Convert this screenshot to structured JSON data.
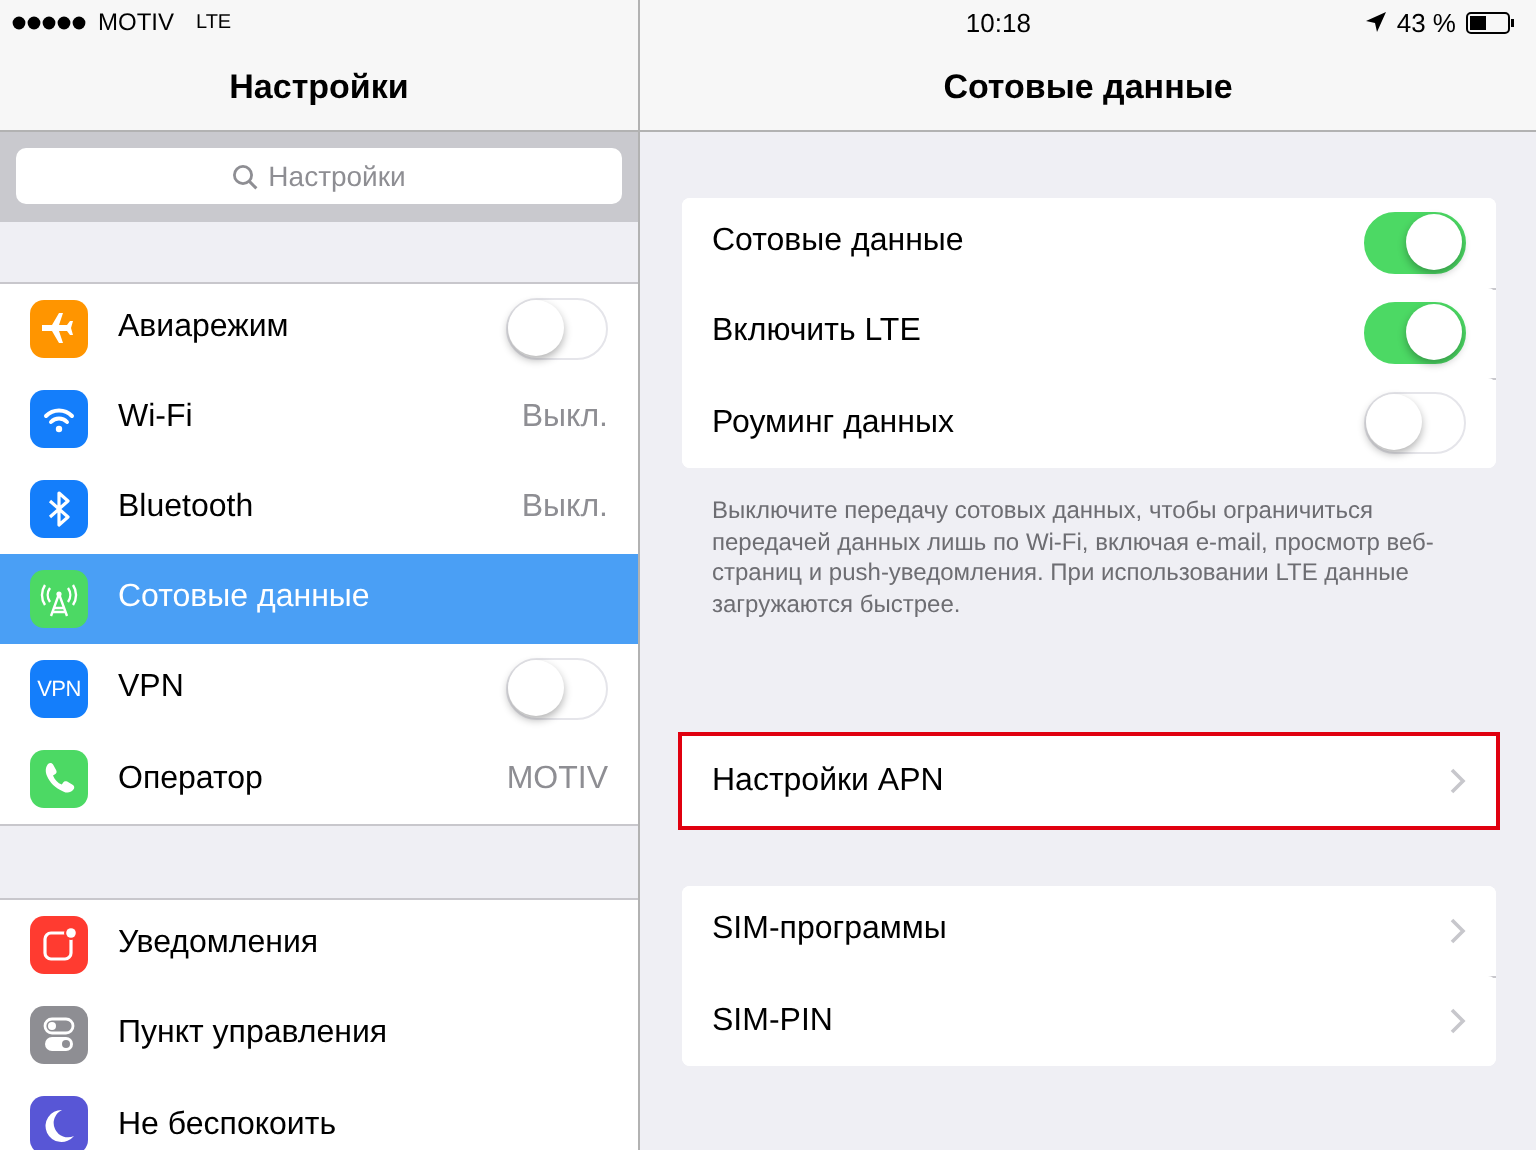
{
  "status_bar": {
    "carrier": "MOTIV",
    "network": "LTE",
    "time": "10:18",
    "battery": "43 %"
  },
  "left": {
    "title": "Настройки",
    "search": {
      "placeholder": "Настройки"
    },
    "groups": [
      [
        {
          "color": "#ff9500",
          "label": "Авиарежим",
          "kind": "toggle",
          "on": false,
          "selected": false
        },
        {
          "color": "#147efb",
          "label": "Wi-Fi",
          "kind": "value",
          "value": "Выкл.",
          "selected": false
        },
        {
          "color": "#147efb",
          "label": "Bluetooth",
          "kind": "value",
          "value": "Выкл.",
          "selected": false
        },
        {
          "color": "#4cd964",
          "label": "Сотовые данные",
          "kind": "plain",
          "selected": true
        },
        {
          "color": "#147efb",
          "icon_text": "VPN",
          "label": "VPN",
          "kind": "toggle",
          "on": false,
          "selected": false
        },
        {
          "color": "#4cd964",
          "label": "Оператор",
          "kind": "value",
          "value": "MOTIV",
          "selected": false
        }
      ],
      [
        {
          "color": "#ff3b30",
          "label": "Уведомления",
          "kind": "plain",
          "selected": false
        },
        {
          "color": "#8e8e93",
          "label": "Пункт управления",
          "kind": "plain",
          "selected": false
        },
        {
          "color": "#5856d6",
          "label": "Не беспокоить",
          "kind": "plain",
          "selected": false
        }
      ]
    ]
  },
  "right": {
    "title": "Сотовые данные",
    "groups": [
      {
        "rows": [
          {
            "label": "Сотовые данные",
            "kind": "toggle",
            "on": true
          },
          {
            "label": "Включить LTE",
            "kind": "toggle",
            "on": true
          },
          {
            "label": "Роуминг данных",
            "kind": "toggle",
            "on": false
          }
        ],
        "footer": "Выключите передачу сотовых данных, чтобы ограничиться передачей данных лишь по Wi-Fi, включая e-mail, просмотр веб-страниц и push-уведомления. При использовании LTE данные загружаются быстрее."
      },
      {
        "rows": [
          {
            "label": "Настройки APN",
            "kind": "link",
            "highlighted": true
          }
        ]
      },
      {
        "rows": [
          {
            "label": "SIM-программы",
            "kind": "link",
            "highlighted": false
          },
          {
            "label": "SIM-PIN",
            "kind": "link",
            "highlighted": false
          }
        ]
      }
    ]
  }
}
